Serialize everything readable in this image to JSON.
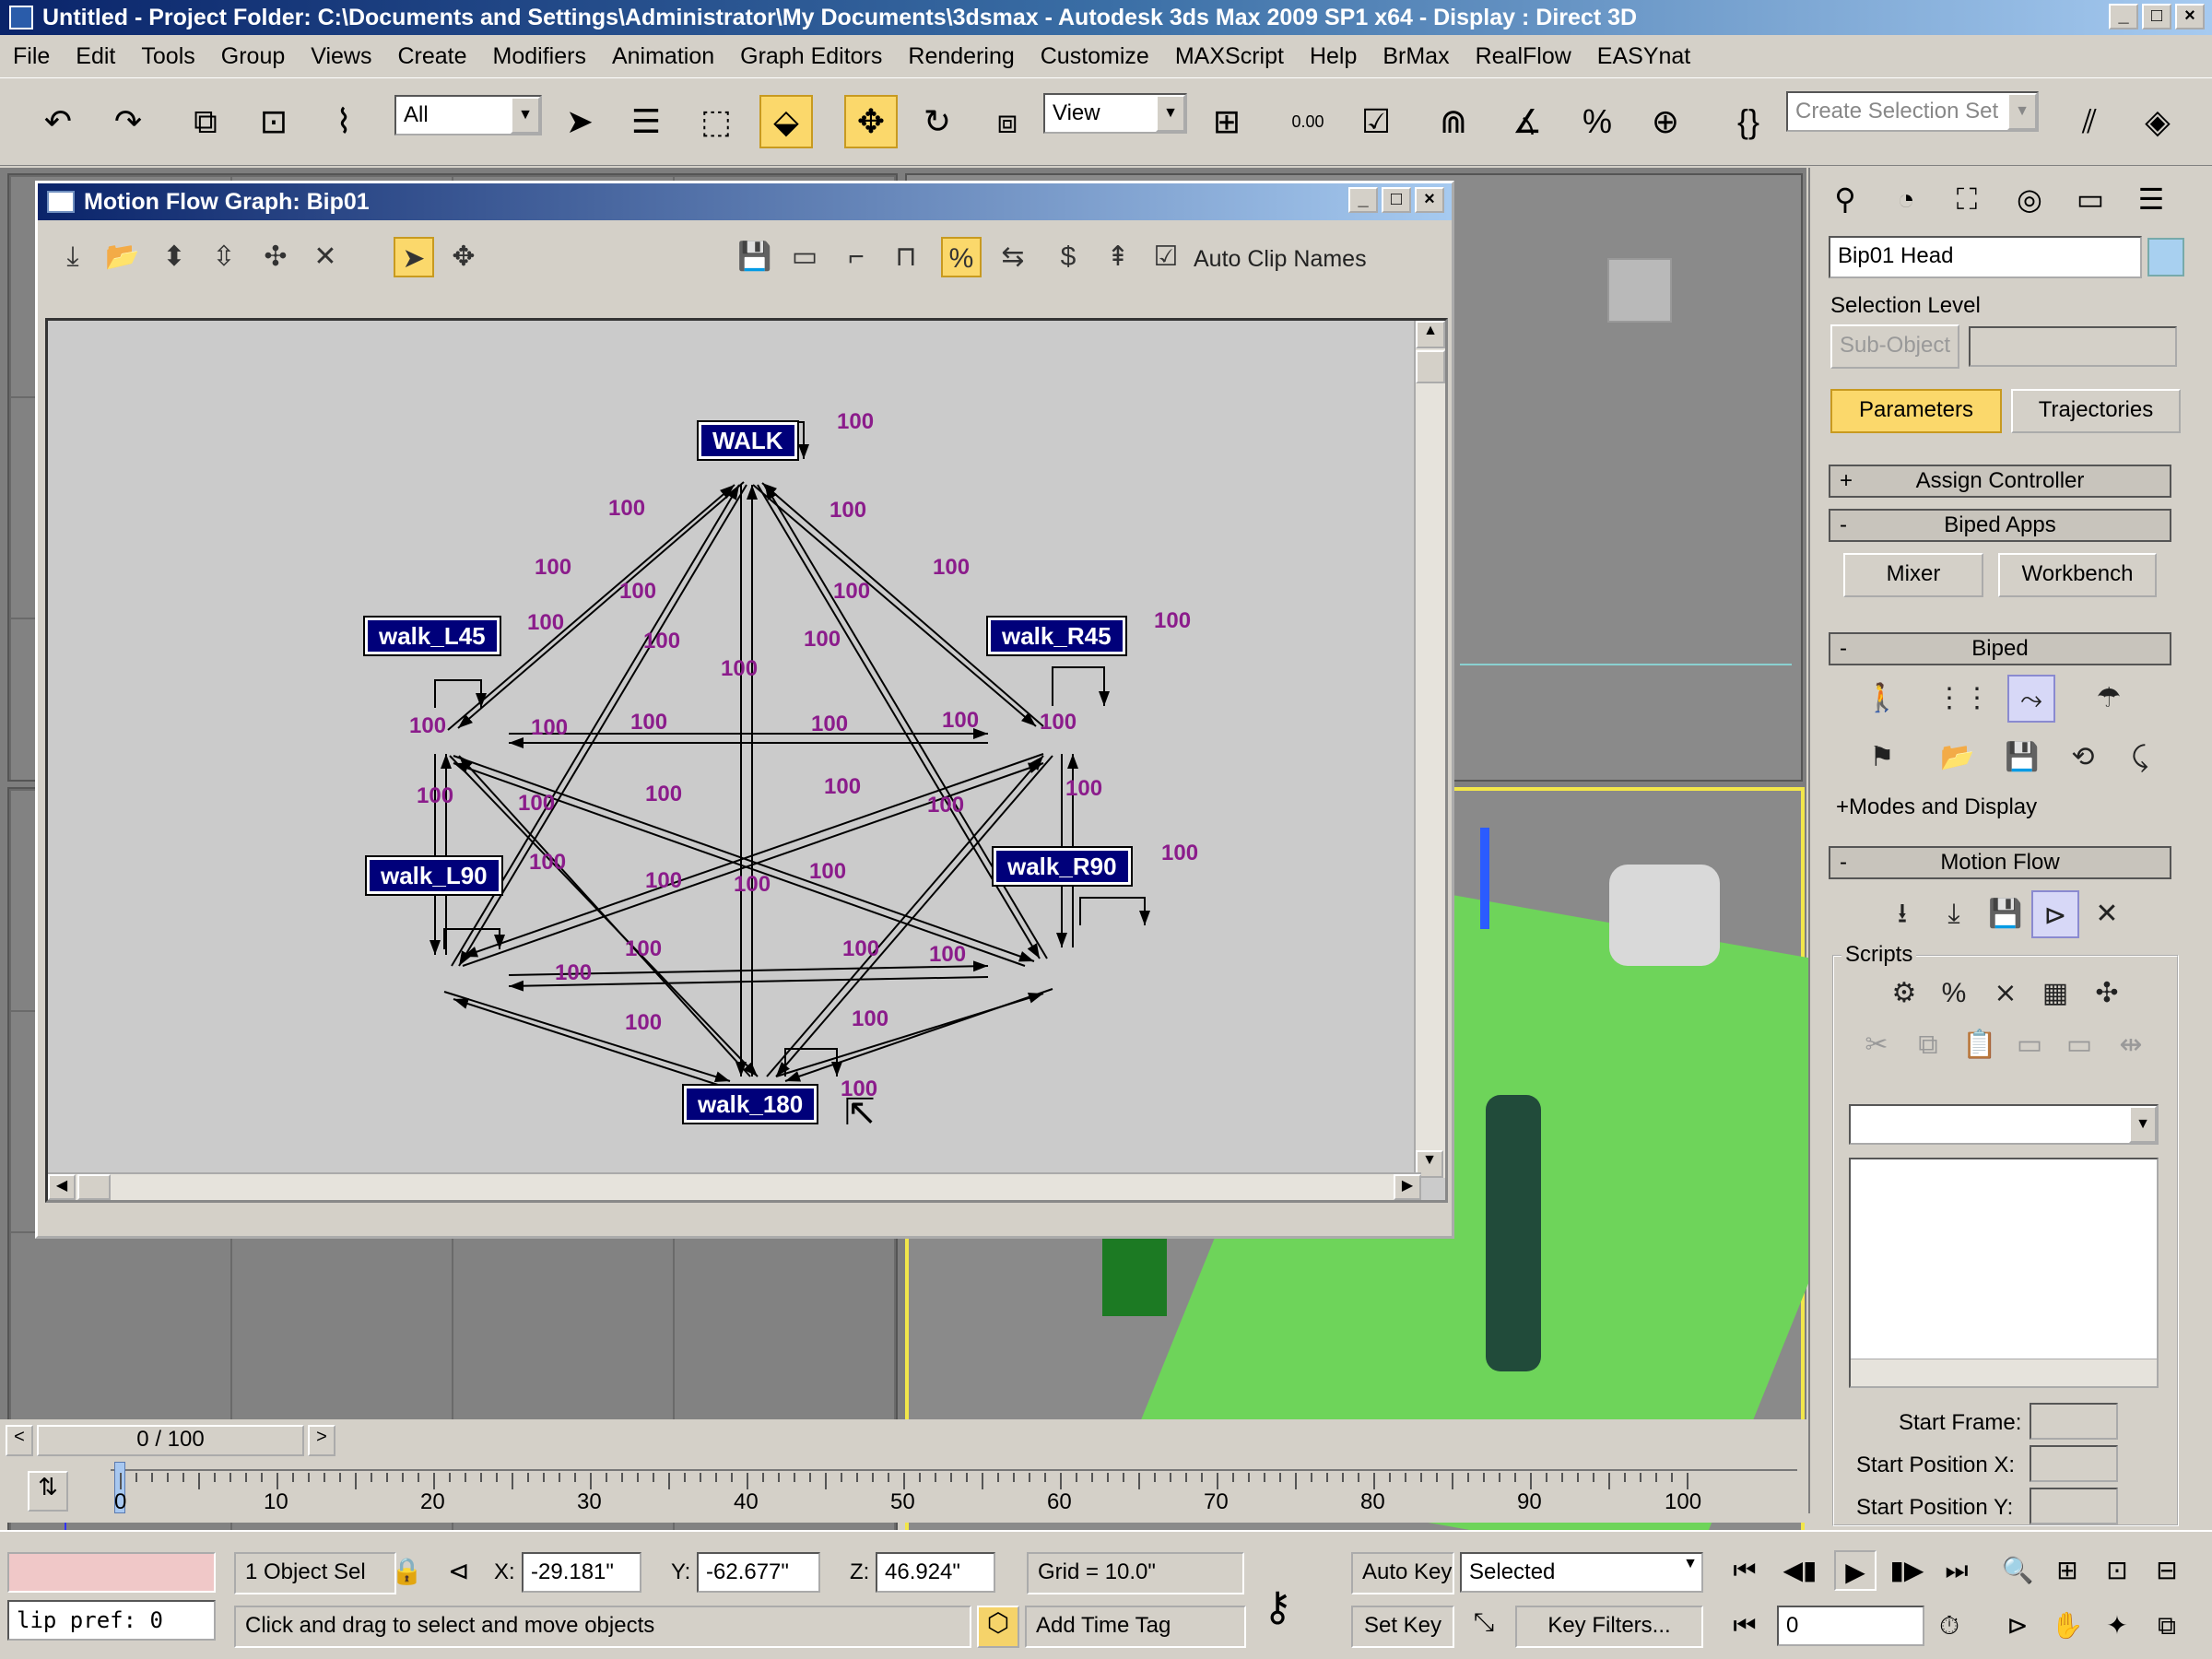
{
  "window": {
    "title": "Untitled    - Project Folder: C:\\Documents and Settings\\Administrator\\My Documents\\3dsmax    - Autodesk 3ds Max  2009 SP1  x64        - Display : Direct 3D"
  },
  "menu": [
    "File",
    "Edit",
    "Tools",
    "Group",
    "Views",
    "Create",
    "Modifiers",
    "Animation",
    "Graph Editors",
    "Rendering",
    "Customize",
    "MAXScript",
    "Help",
    "BrMax",
    "RealFlow",
    "EASYnat"
  ],
  "toolbar": {
    "filter": "All",
    "ref_coord": "View",
    "selection_set_placeholder": "Create Selection Set",
    "snap_value": "0.00"
  },
  "icons": {
    "undo": "undo-icon",
    "redo": "redo-icon",
    "move": "move-icon",
    "rotate": "rotate-icon",
    "scale": "scale-icon"
  },
  "motion_flow": {
    "title": "Motion Flow Graph: Bip01",
    "auto_clip_names_label": "Auto Clip Names",
    "auto_clip_names_checked": true,
    "nodes": [
      "WALK",
      "walk_L45",
      "walk_R45",
      "walk_L90",
      "walk_R90",
      "walk_180"
    ],
    "weight": "100"
  },
  "command_panel": {
    "object_name": "Bip01 Head",
    "selection_level_label": "Selection Level",
    "sub_object_label": "Sub-Object",
    "tab_parameters": "Parameters",
    "tab_trajectories": "Trajectories",
    "rollout_assign_controller": "Assign Controller",
    "rollout_biped_apps": "Biped Apps",
    "mixer": "Mixer",
    "workbench": "Workbench",
    "rollout_biped": "Biped",
    "modes_and_display": "+Modes and Display",
    "rollout_motion_flow": "Motion Flow",
    "scripts_label": "Scripts",
    "start_frame": "Start Frame:",
    "start_pos_x": "Start Position X:",
    "start_pos_y": "Start Position Y:"
  },
  "timeline": {
    "frame_label": "0 / 100",
    "ticks": [
      "0",
      "10",
      "20",
      "30",
      "40",
      "50",
      "60",
      "70",
      "80",
      "90",
      "100"
    ]
  },
  "status": {
    "maxscript_listener": "lip pref: 0",
    "selection": "1 Object Sel",
    "x": "-29.181\"",
    "y": "-62.677\"",
    "z": "46.924\"",
    "grid": "Grid = 10.0\"",
    "prompt": "Click and drag to select and move objects",
    "add_time_tag": "Add Time Tag",
    "auto_key": "Auto Key",
    "set_key": "Set Key",
    "key_mode": "Selected",
    "key_filters": "Key Filters...",
    "frame": "0",
    "x_label": "X:",
    "y_label": "Y:",
    "z_label": "Z:"
  }
}
